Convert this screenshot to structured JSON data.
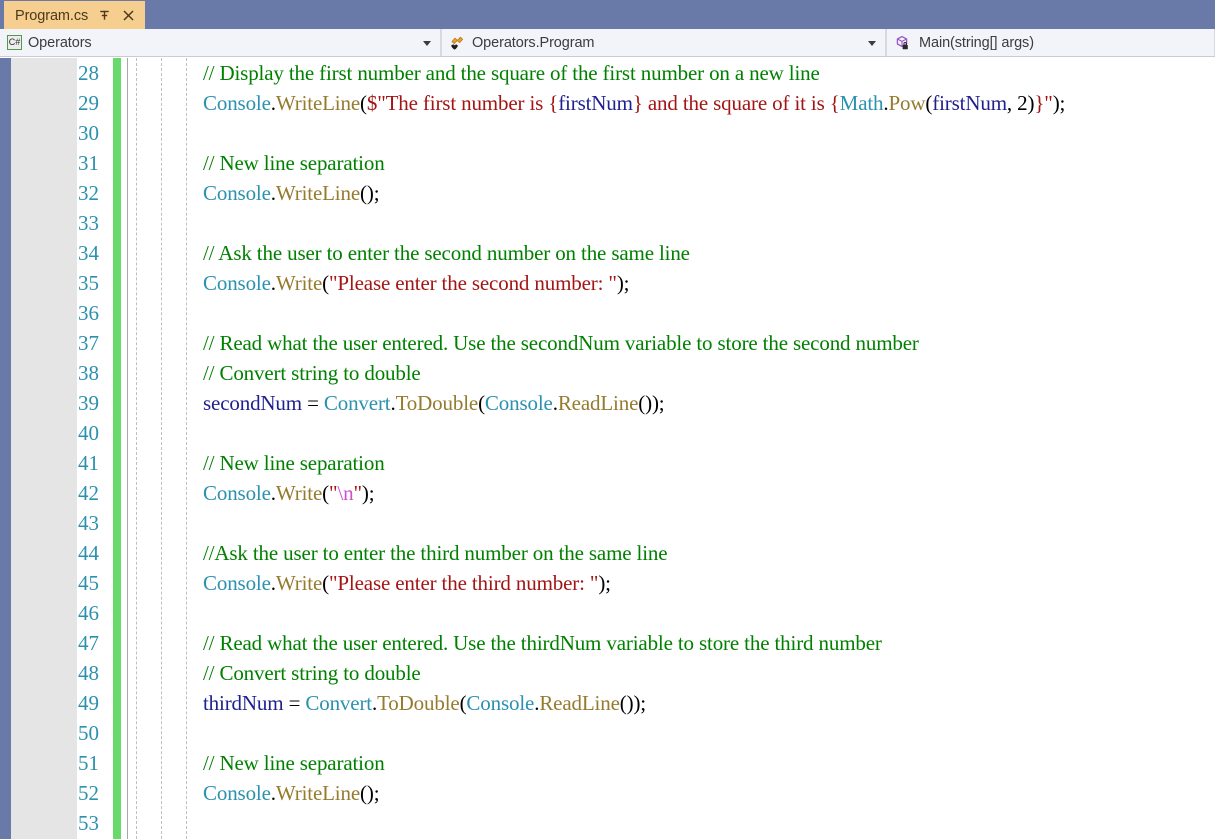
{
  "window": {
    "tab": {
      "title": "Program.cs",
      "pin_icon": "pin-icon",
      "close_icon": "close-icon"
    }
  },
  "navbar": {
    "project_combo": {
      "icon": "csharp-file-icon",
      "label": "Operators",
      "dropdown_icon": "chevron-down-icon"
    },
    "type_combo": {
      "icon": "class-icon",
      "label": "Operators.Program",
      "dropdown_icon": "chevron-down-icon"
    },
    "member_combo": {
      "icon": "method-private-icon",
      "label": "Main(string[] args)",
      "dropdown_icon": "chevron-down-icon"
    }
  },
  "editor": {
    "language": "csharp",
    "colors": {
      "comment": "#008000",
      "type": "#2B91AF",
      "method": "#957B2E",
      "string": "#A31515",
      "variable": "#1F1F8F",
      "escape": "#CF4FCF",
      "plain": "#000000",
      "line_number": "#2B91AF",
      "change_bar": "#68D96B",
      "background": "#FFFFFF",
      "gutter": "#E5E5E5",
      "edge_strip": "#6A7AA8",
      "tab": "#F6CE8F"
    },
    "first_visible_line": 28,
    "lines": [
      {
        "number": "28",
        "tokens": [
          {
            "text": "// Display the first number and the square of the first number on a new line",
            "cls": "t-comment"
          }
        ]
      },
      {
        "number": "29",
        "tokens": [
          {
            "text": "Console",
            "cls": "t-type"
          },
          {
            "text": ".",
            "cls": "t-plain"
          },
          {
            "text": "WriteLine",
            "cls": "t-method"
          },
          {
            "text": "(",
            "cls": "t-plain"
          },
          {
            "text": "$\"The first number is ",
            "cls": "t-string"
          },
          {
            "text": "{",
            "cls": "t-brace"
          },
          {
            "text": "firstNum",
            "cls": "t-var"
          },
          {
            "text": "}",
            "cls": "t-brace"
          },
          {
            "text": " and the square of it is ",
            "cls": "t-string"
          },
          {
            "text": "{",
            "cls": "t-brace"
          },
          {
            "text": "Math",
            "cls": "t-type"
          },
          {
            "text": ".",
            "cls": "t-plain"
          },
          {
            "text": "Pow",
            "cls": "t-method"
          },
          {
            "text": "(",
            "cls": "t-plain"
          },
          {
            "text": "firstNum",
            "cls": "t-var"
          },
          {
            "text": ", ",
            "cls": "t-plain"
          },
          {
            "text": "2",
            "cls": "t-number"
          },
          {
            "text": ")",
            "cls": "t-plain"
          },
          {
            "text": "}",
            "cls": "t-brace"
          },
          {
            "text": "\"",
            "cls": "t-string"
          },
          {
            "text": ");",
            "cls": "t-plain"
          }
        ]
      },
      {
        "number": "30",
        "tokens": []
      },
      {
        "number": "31",
        "tokens": [
          {
            "text": "// New line separation",
            "cls": "t-comment"
          }
        ]
      },
      {
        "number": "32",
        "tokens": [
          {
            "text": "Console",
            "cls": "t-type"
          },
          {
            "text": ".",
            "cls": "t-plain"
          },
          {
            "text": "WriteLine",
            "cls": "t-method"
          },
          {
            "text": "();",
            "cls": "t-plain"
          }
        ]
      },
      {
        "number": "33",
        "tokens": []
      },
      {
        "number": "34",
        "tokens": [
          {
            "text": "// Ask the user to enter the second number on the same line",
            "cls": "t-comment"
          }
        ]
      },
      {
        "number": "35",
        "tokens": [
          {
            "text": "Console",
            "cls": "t-type"
          },
          {
            "text": ".",
            "cls": "t-plain"
          },
          {
            "text": "Write",
            "cls": "t-method"
          },
          {
            "text": "(",
            "cls": "t-plain"
          },
          {
            "text": "\"Please enter the second number: \"",
            "cls": "t-string"
          },
          {
            "text": ");",
            "cls": "t-plain"
          }
        ]
      },
      {
        "number": "36",
        "tokens": []
      },
      {
        "number": "37",
        "tokens": [
          {
            "text": "// Read what the user entered. Use the secondNum variable to store the second number",
            "cls": "t-comment"
          }
        ]
      },
      {
        "number": "38",
        "tokens": [
          {
            "text": "// Convert string to double",
            "cls": "t-comment"
          }
        ]
      },
      {
        "number": "39",
        "tokens": [
          {
            "text": "secondNum",
            "cls": "t-var"
          },
          {
            "text": " = ",
            "cls": "t-plain"
          },
          {
            "text": "Convert",
            "cls": "t-type"
          },
          {
            "text": ".",
            "cls": "t-plain"
          },
          {
            "text": "ToDouble",
            "cls": "t-method"
          },
          {
            "text": "(",
            "cls": "t-plain"
          },
          {
            "text": "Console",
            "cls": "t-type"
          },
          {
            "text": ".",
            "cls": "t-plain"
          },
          {
            "text": "ReadLine",
            "cls": "t-method"
          },
          {
            "text": "());",
            "cls": "t-plain"
          }
        ]
      },
      {
        "number": "40",
        "tokens": []
      },
      {
        "number": "41",
        "tokens": [
          {
            "text": "// New line separation",
            "cls": "t-comment"
          }
        ]
      },
      {
        "number": "42",
        "tokens": [
          {
            "text": "Console",
            "cls": "t-type"
          },
          {
            "text": ".",
            "cls": "t-plain"
          },
          {
            "text": "Write",
            "cls": "t-method"
          },
          {
            "text": "(",
            "cls": "t-plain"
          },
          {
            "text": "\"",
            "cls": "t-string"
          },
          {
            "text": "\\n",
            "cls": "t-escape"
          },
          {
            "text": "\"",
            "cls": "t-string"
          },
          {
            "text": ");",
            "cls": "t-plain"
          }
        ]
      },
      {
        "number": "43",
        "tokens": []
      },
      {
        "number": "44",
        "tokens": [
          {
            "text": "//Ask the user to enter the third number on the same line",
            "cls": "t-comment"
          }
        ]
      },
      {
        "number": "45",
        "tokens": [
          {
            "text": "Console",
            "cls": "t-type"
          },
          {
            "text": ".",
            "cls": "t-plain"
          },
          {
            "text": "Write",
            "cls": "t-method"
          },
          {
            "text": "(",
            "cls": "t-plain"
          },
          {
            "text": "\"Please enter the third number: \"",
            "cls": "t-string"
          },
          {
            "text": ");",
            "cls": "t-plain"
          }
        ]
      },
      {
        "number": "46",
        "tokens": []
      },
      {
        "number": "47",
        "tokens": [
          {
            "text": "// Read what the user entered. Use the thirdNum variable to store the third number",
            "cls": "t-comment"
          }
        ]
      },
      {
        "number": "48",
        "tokens": [
          {
            "text": "// Convert string to double",
            "cls": "t-comment"
          }
        ]
      },
      {
        "number": "49",
        "tokens": [
          {
            "text": "thirdNum",
            "cls": "t-var"
          },
          {
            "text": " = ",
            "cls": "t-plain"
          },
          {
            "text": "Convert",
            "cls": "t-type"
          },
          {
            "text": ".",
            "cls": "t-plain"
          },
          {
            "text": "ToDouble",
            "cls": "t-method"
          },
          {
            "text": "(",
            "cls": "t-plain"
          },
          {
            "text": "Console",
            "cls": "t-type"
          },
          {
            "text": ".",
            "cls": "t-plain"
          },
          {
            "text": "ReadLine",
            "cls": "t-method"
          },
          {
            "text": "());",
            "cls": "t-plain"
          }
        ]
      },
      {
        "number": "50",
        "tokens": []
      },
      {
        "number": "51",
        "tokens": [
          {
            "text": "// New line separation",
            "cls": "t-comment"
          }
        ]
      },
      {
        "number": "52",
        "tokens": [
          {
            "text": "Console",
            "cls": "t-type"
          },
          {
            "text": ".",
            "cls": "t-plain"
          },
          {
            "text": "WriteLine",
            "cls": "t-method"
          },
          {
            "text": "();",
            "cls": "t-plain"
          }
        ]
      },
      {
        "number": "53",
        "tokens": []
      }
    ]
  }
}
